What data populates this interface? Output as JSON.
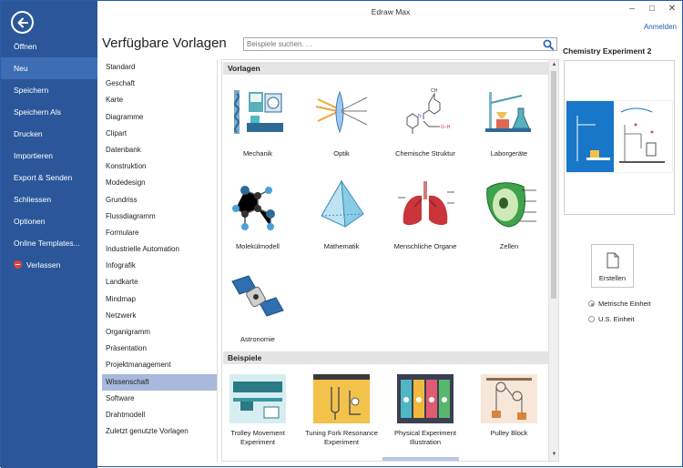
{
  "app": {
    "title": "Edraw Max",
    "login": "Anmelden",
    "window_controls": {
      "minimize": "–",
      "restore": "□",
      "close": "✕"
    }
  },
  "sidebar": {
    "back_icon": "back-arrow-icon",
    "items": [
      {
        "label": "Öffnen",
        "active": false
      },
      {
        "label": "Neu",
        "active": true
      },
      {
        "label": "Speichern",
        "active": false
      },
      {
        "label": "Speichern Als",
        "active": false
      },
      {
        "label": "Drucken",
        "active": false
      },
      {
        "label": "Importieren",
        "active": false
      },
      {
        "label": "Export & Senden",
        "active": false
      },
      {
        "label": "Schliessen",
        "active": false
      },
      {
        "label": "Optionen",
        "active": false
      },
      {
        "label": "Online Templates...",
        "active": false
      },
      {
        "label": "Verlassen",
        "active": false
      }
    ]
  },
  "header": {
    "title": "Verfügbare Vorlagen",
    "search_placeholder": "Beispiele suchen. . ."
  },
  "categories": [
    "Standard",
    "Geschaft",
    "Karte",
    "Diagramme",
    "Clipart",
    "Datenbank",
    "Konstruktion",
    "Modedesign",
    "Grundriss",
    "Flussdiagramm",
    "Formulare",
    "Industrielle Automation",
    "Infografik",
    "Landkarte",
    "Mindmap",
    "Netzwerk",
    "Organigramm",
    "Präsentation",
    "Projektmanagement",
    "Wissenschaft",
    "Software",
    "Drahtmodell",
    "Zuletzt genutzte Vorlagen"
  ],
  "selected_category": "Wissenschaft",
  "gallery": {
    "templates_header": "Vorlagen",
    "templates": [
      {
        "label": "Mechanik",
        "icon": "mechanics-icon"
      },
      {
        "label": "Optik",
        "icon": "optics-icon"
      },
      {
        "label": "Chemische Struktur",
        "icon": "chemical-structure-icon"
      },
      {
        "label": "Laborgeräte",
        "icon": "lab-equipment-icon"
      },
      {
        "label": "Molekülmodell",
        "icon": "molecule-model-icon"
      },
      {
        "label": "Mathematik",
        "icon": "pyramid-icon"
      },
      {
        "label": "Menschliche Organe",
        "icon": "lungs-icon"
      },
      {
        "label": "Zellen",
        "icon": "cell-icon"
      },
      {
        "label": "Astronomie",
        "icon": "satellite-icon"
      }
    ],
    "examples_header": "Beispiele",
    "examples": [
      {
        "label": "Trolley Movement Experiment",
        "icon": "trolley-experiment-thumb"
      },
      {
        "label": "Tuning Fork Resonance Experiment",
        "icon": "tuning-fork-thumb"
      },
      {
        "label": "Physical Experiment Illustration",
        "icon": "physical-experiment-thumb"
      },
      {
        "label": "Pulley Block",
        "icon": "pulley-block-thumb"
      }
    ]
  },
  "preview": {
    "title": "Chemistry Experiment 2"
  },
  "create": {
    "label": "Erstellen",
    "icon": "new-document-icon"
  },
  "units": [
    {
      "label": "Metrische Einheit",
      "selected": true
    },
    {
      "label": "U.S. Einheit",
      "selected": false
    }
  ],
  "colors": {
    "sidebar": "#2b579a",
    "selected_category": "#a7b9dc",
    "link": "#1e5fb4"
  }
}
